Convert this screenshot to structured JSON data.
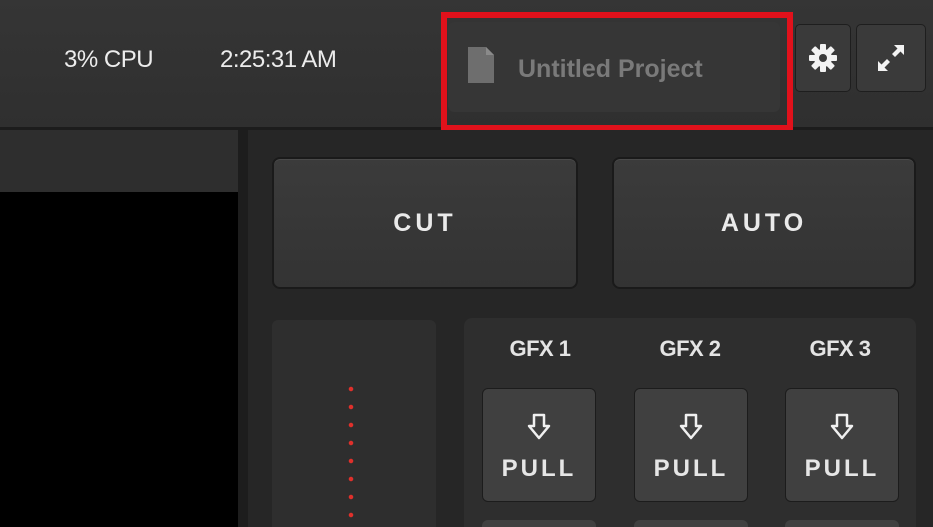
{
  "status": {
    "cpu": "3% CPU",
    "clock": "2:25:31 AM"
  },
  "project": {
    "title": "Untitled Project",
    "icon": "document-icon"
  },
  "toolbar": {
    "settings_icon": "gear-icon",
    "fullscreen_icon": "expand-icon"
  },
  "transition": {
    "cut_label": "CUT",
    "auto_label": "AUTO"
  },
  "gfx": [
    {
      "label": "GFX 1",
      "button": "PULL",
      "icon": "arrow-down-icon"
    },
    {
      "label": "GFX 2",
      "button": "PULL",
      "icon": "arrow-down-icon"
    },
    {
      "label": "GFX 3",
      "button": "PULL",
      "icon": "arrow-down-icon"
    }
  ],
  "colors": {
    "highlight": "#e0111b",
    "tbar_dots": "#e0302b",
    "project_text": "#7a7a7a"
  }
}
